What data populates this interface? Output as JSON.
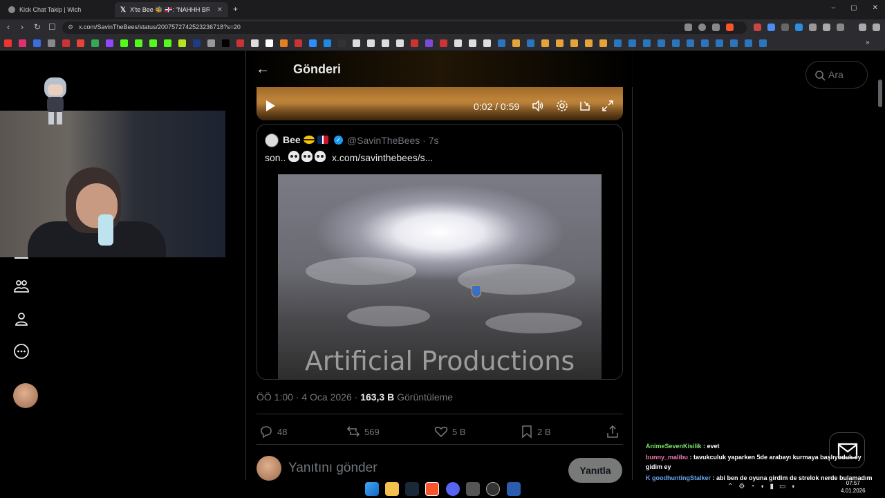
{
  "browser": {
    "tabs": [
      {
        "label": "Kick Chat Takip | Wich",
        "active": false
      },
      {
        "label": "X'te Bee 🐝 🇩🇴: \"NAHHH BRO",
        "active": true
      }
    ],
    "new_tab": "+",
    "window_controls": [
      "–",
      "▢",
      "✕"
    ],
    "url": "x.com/SavinTheBees/status/2007572742523236718?s=20"
  },
  "header": {
    "title": "Gönderi"
  },
  "video": {
    "time": "0:02 / 0:59",
    "progress": 0.034
  },
  "quote": {
    "name": "Bee",
    "handle": "@SavinTheBees · 7s",
    "text_prefix": "son..",
    "link": "x.com/savinthebees/s...",
    "media_watermark": "Artificial Productions"
  },
  "meta": {
    "time": "ÖÖ 1:00 · 4 Oca 2026 · ",
    "views_count": "163,3 B",
    "views_label": " Görüntüleme"
  },
  "actions": {
    "replies": "48",
    "reposts": "569",
    "likes": "5 B",
    "bookmarks": "2 B"
  },
  "reply": {
    "placeholder": "Yanıtını gönder",
    "button": "Yanıtla"
  },
  "search": {
    "placeholder": "Ara"
  },
  "chat": [
    {
      "user": "AnimeSevenKisilik",
      "color": "#7ee06a",
      "text": " : evet"
    },
    {
      "user": "bunny_malibu",
      "color": "#f07ab0",
      "text": " : tavukculuk yaparken 5de arabayı kurmaya başlıyoduk ey gidim ey"
    },
    {
      "user": "goodhuntingStalker",
      "color": "#6aa7f0",
      "text": " : abi ben de oyuna girdim de strelok nerde bulamadım"
    }
  ],
  "clock": {
    "time": "07:57",
    "date": "4.01.2026"
  },
  "colors": {
    "accent": "#1d9bf0",
    "background": "#000000",
    "muted_text": "#71767b"
  }
}
